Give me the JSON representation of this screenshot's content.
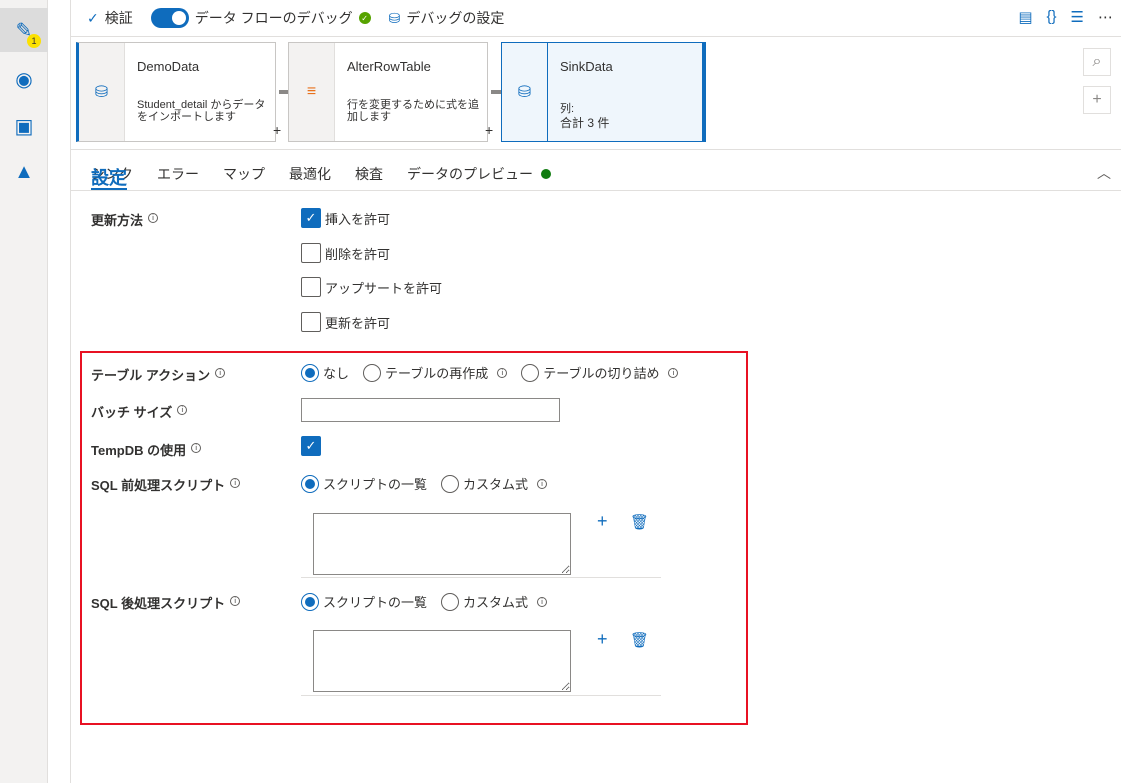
{
  "sidebar": {
    "items": [
      {
        "icon": "pencil-icon",
        "badge": "1"
      },
      {
        "icon": "monitor-icon"
      },
      {
        "icon": "toolbox-icon"
      },
      {
        "icon": "learn-icon"
      }
    ]
  },
  "toolbar": {
    "validate": "検証",
    "debug": "データ フローのデバッグ",
    "debug_settings": "デバッグの設定"
  },
  "nodes": [
    {
      "title": "DemoData",
      "desc": "Student_detail からデータをインポートします"
    },
    {
      "title": "AlterRowTable",
      "desc": "行を変更するために式を追加します"
    },
    {
      "title": "SinkData",
      "desc_label": "列:",
      "desc": "合計 3 件"
    }
  ],
  "tabs": [
    "シンク",
    "設定",
    "エラー",
    "マップ",
    "最適化",
    "検査",
    "データのプレビュー"
  ],
  "active_tab": "設定",
  "settings": {
    "update_method": "更新方法",
    "checks": [
      {
        "label": "挿入を許可",
        "checked": true
      },
      {
        "label": "削除を許可",
        "checked": false
      },
      {
        "label": "アップサートを許可",
        "checked": false
      },
      {
        "label": "更新を許可",
        "checked": false
      }
    ],
    "table_action": "テーブル アクション",
    "table_action_options": [
      "なし",
      "テーブルの再作成",
      "テーブルの切り詰め"
    ],
    "batch_size": "バッチ サイズ",
    "batch_size_value": "",
    "tempdb": "TempDB の使用",
    "tempdb_checked": true,
    "pre_sql": "SQL 前処理スクリプト",
    "post_sql": "SQL 後処理スクリプト",
    "script_options": [
      "スクリプトの一覧",
      "カスタム式"
    ]
  }
}
